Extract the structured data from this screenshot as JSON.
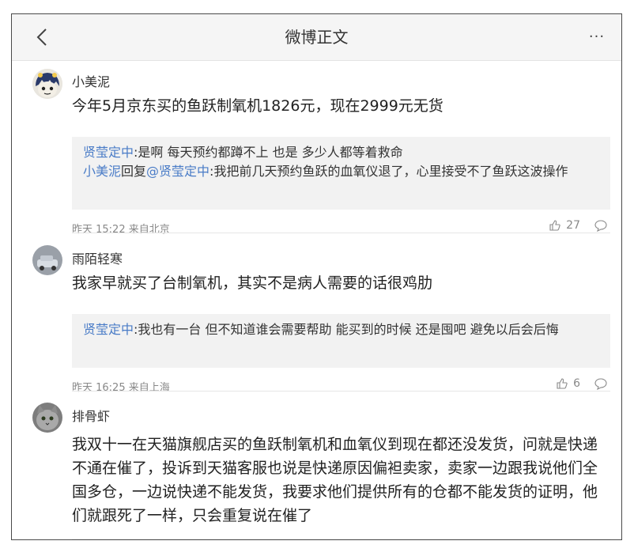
{
  "header": {
    "title": "微博正文",
    "more": "···"
  },
  "comments": [
    {
      "username": "小美泥",
      "text": "今年5月京东买的鱼跃制氧机1826元，现在2999元无货",
      "replies": [
        {
          "name": "贤莹定中",
          "text": ":是啊 每天预约都蹲不上 也是 多少人都等着救命"
        },
        {
          "name": "小美泥",
          "middle": "回复",
          "target": "@贤莹定中",
          "text": ":我把前几天预约鱼跃的血氧仪退了，心里接受不了鱼跃这波操作"
        }
      ],
      "meta": "昨天 15:22 来自北京",
      "likes": "27"
    },
    {
      "username": "雨陌轻寒",
      "text": "我家早就买了台制氧机，其实不是病人需要的话很鸡肋",
      "replies": [
        {
          "name": "贤莹定中",
          "text": ":我也有一台 但不知道谁会需要帮助 能买到的时候 还是囤吧 避免以后会后悔"
        }
      ],
      "meta": "昨天 16:25 来自上海",
      "likes": "6"
    },
    {
      "username": "排骨虾",
      "text": "我双十一在天猫旗舰店买的鱼跃制氧机和血氧仪到现在都还没发货，问就是快递不通在催了，投诉到天猫客服也说是快递原因偏袒卖家，卖家一边跟我说他们全国多仓，一边说快递不能发货，我要求他们提供所有的仓都不能发货的证明，他们就跟死了一样，只会重复说在催了"
    }
  ]
}
